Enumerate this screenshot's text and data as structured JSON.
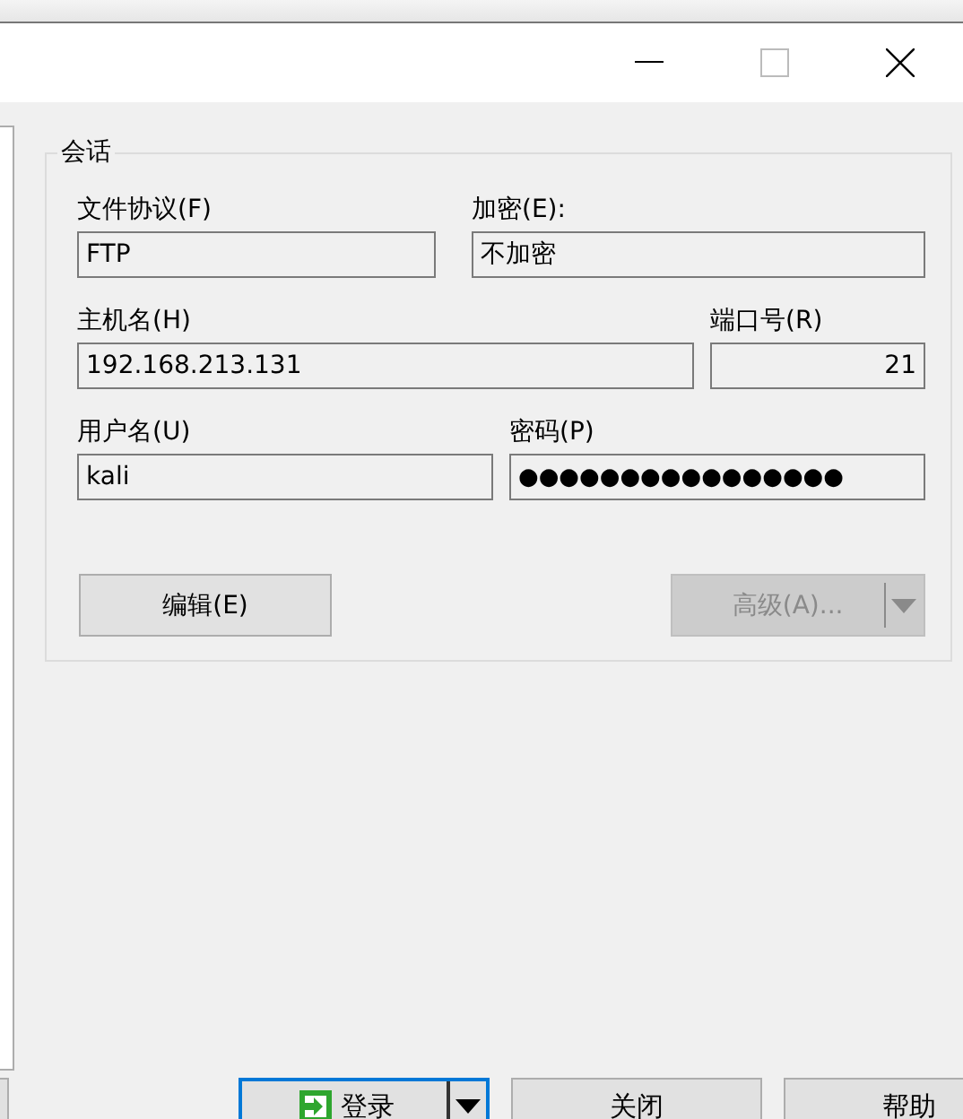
{
  "group": {
    "title": "会话"
  },
  "fields": [
    {
      "label": "文件协议(F)",
      "value": "FTP",
      "kind": "text"
    },
    {
      "label": "加密(E):",
      "value": "不加密",
      "kind": "text"
    },
    {
      "label": "主机名(H)",
      "value": "192.168.213.131",
      "kind": "text"
    },
    {
      "label": "端口号(R)",
      "value": "21",
      "kind": "number"
    },
    {
      "label": "用户名(U)",
      "value": "kali",
      "kind": "text"
    },
    {
      "label": "密码(P)",
      "value": "●●●●●●●●●●●●●●●●",
      "kind": "password"
    }
  ],
  "group_buttons": [
    {
      "label": "编辑(E)",
      "disabled": false,
      "dropdown": false
    },
    {
      "label": "高级(A)...",
      "disabled": true,
      "dropdown": true
    }
  ],
  "footer_buttons": [
    {
      "label": "登录",
      "default": true,
      "dropdown": true
    },
    {
      "label": "关闭",
      "default": false,
      "dropdown": false
    },
    {
      "label": "帮助",
      "default": false,
      "dropdown": false
    }
  ]
}
